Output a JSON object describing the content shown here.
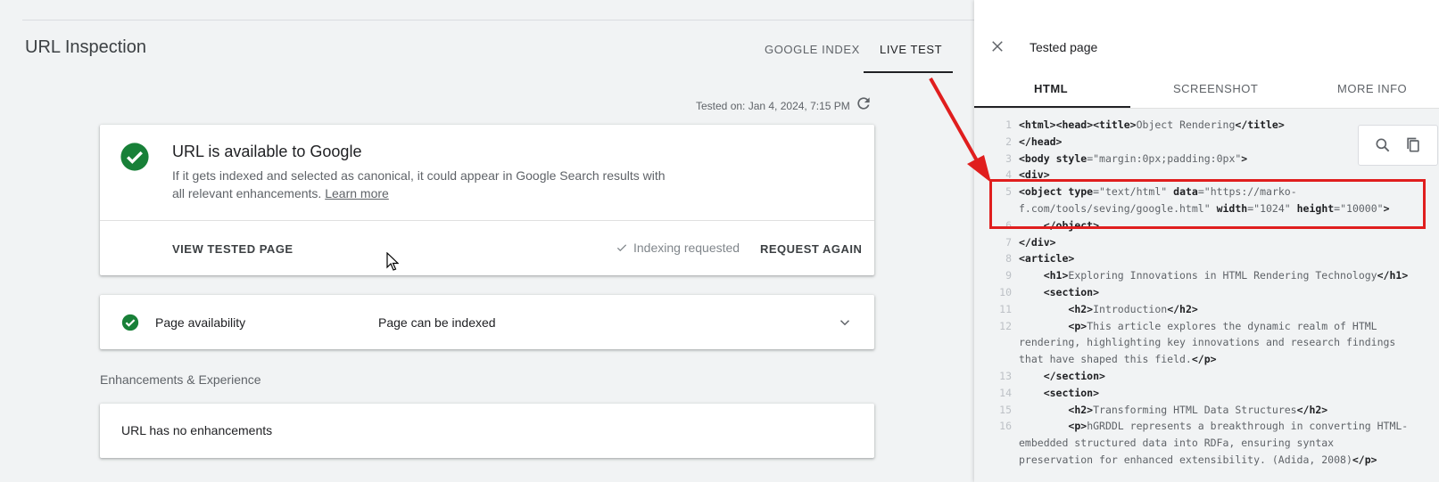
{
  "header": {
    "title": "URL Inspection",
    "tabs": [
      "GOOGLE INDEX",
      "LIVE TEST"
    ]
  },
  "tested_on": "Tested on: Jan 4, 2024, 7:15 PM",
  "status_card": {
    "heading": "URL is available to Google",
    "description": "If it gets indexed and selected as canonical, it could appear in Google Search results with all relevant enhancements.",
    "learn_more": "Learn more",
    "view_button": "VIEW TESTED PAGE",
    "indexing_status": "Indexing requested",
    "request_again_button": "REQUEST AGAIN"
  },
  "availability": {
    "label": "Page availability",
    "value": "Page can be indexed"
  },
  "enhancements": {
    "heading": "Enhancements & Experience",
    "message": "URL has no enhancements"
  },
  "panel": {
    "title": "Tested page",
    "tabs": [
      "HTML",
      "SCREENSHOT",
      "MORE INFO"
    ]
  },
  "code_lines": [
    {
      "n": "1",
      "t": "<html><head><title>Object Rendering</title>"
    },
    {
      "n": "2",
      "t": "</head>"
    },
    {
      "n": "3",
      "t": "<body style=\"margin:0px;padding:0px\">"
    },
    {
      "n": "4",
      "t": "<div>"
    },
    {
      "n": "5",
      "t": "<object type=\"text/html\" data=\"https://marko-f.com/tools/seving/google.html\" width=\"1024\" height=\"10000\">"
    },
    {
      "n": "6",
      "t": "    </object>"
    },
    {
      "n": "7",
      "t": "</div>"
    },
    {
      "n": "8",
      "t": "<article>"
    },
    {
      "n": "9",
      "t": "    <h1>Exploring Innovations in HTML Rendering Technology</h1>"
    },
    {
      "n": "10",
      "t": "    <section>"
    },
    {
      "n": "11",
      "t": "        <h2>Introduction</h2>"
    },
    {
      "n": "12",
      "t": "        <p>This article explores the dynamic realm of HTML rendering, highlighting key innovations and research findings that have shaped this field.</p>"
    },
    {
      "n": "13",
      "t": "    </section>"
    },
    {
      "n": "14",
      "t": "    <section>"
    },
    {
      "n": "15",
      "t": "        <h2>Transforming HTML Data Structures</h2>"
    },
    {
      "n": "16",
      "t": "        <p>hGRDDL represents a breakthrough in converting HTML-embedded structured data into RDFa, ensuring syntax preservation for enhanced extensibility. (Adida, 2008)</p>"
    }
  ],
  "colors": {
    "accent": "#188038",
    "annotation": "#e01e1e"
  },
  "icons": [
    "check-circle-icon",
    "refresh-icon",
    "check-icon",
    "chevron-down-icon",
    "close-icon",
    "search-icon",
    "copy-icon"
  ]
}
